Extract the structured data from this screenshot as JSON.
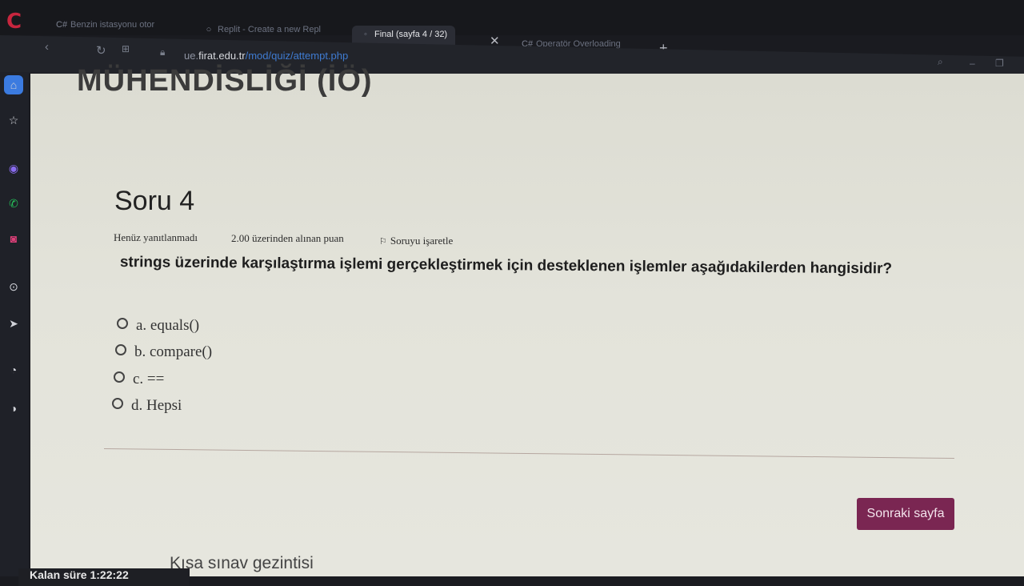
{
  "browser": {
    "tabs": [
      {
        "icon": "C#",
        "label": "Benzin istasyonu otor"
      },
      {
        "icon": "○",
        "label": "Replit - Create a new Repl"
      },
      {
        "icon": "◦",
        "label": "Final (sayfa 4 / 32)"
      },
      {
        "icon": "C#",
        "label": "Operatör Overloading"
      }
    ],
    "url_domain_prefix": "ue.",
    "url_domain": "firat.edu.tr",
    "url_path": "/mod/quiz/attempt.php"
  },
  "page": {
    "heading_cut": "MÜHENDİSLİĞİ (İÖ)",
    "question_title": "Soru 4",
    "status": "Henüz yanıtlanmadı",
    "points": "2.00 üzerinden alınan puan",
    "flag_label": "Soruyu işaretle",
    "question_text": "strings üzerinde karşılaştırma işlemi gerçekleştirmek için desteklenen işlemler aşağıdakilerden hangisidir?",
    "options": [
      "a. equals()",
      "b. compare()",
      "c. ==",
      "d. Hepsi"
    ],
    "next_button": "Sonraki sayfa",
    "nav_title": "Kısa sınav gezintisi",
    "timer": "Kalan süre 1:22:22"
  }
}
